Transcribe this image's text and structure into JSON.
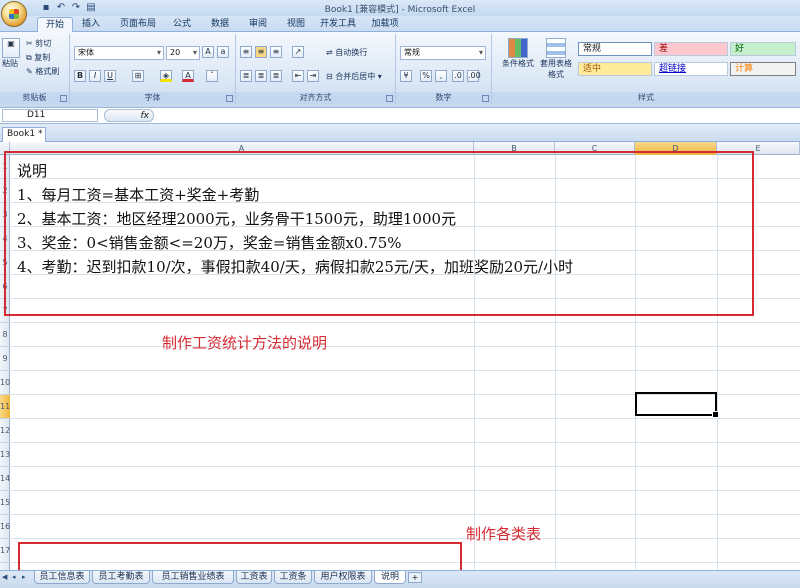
{
  "window": {
    "title": "Book1 [兼容模式] - Microsoft Excel"
  },
  "ribbon": {
    "tabs": [
      "开始",
      "插入",
      "页面布局",
      "公式",
      "数据",
      "审阅",
      "视图",
      "开发工具",
      "加载项"
    ],
    "clipboard": {
      "paste": "粘贴",
      "cut": "剪切",
      "copy": "复制",
      "format_painter": "格式刷",
      "label": "剪贴板"
    },
    "font": {
      "name": "宋体",
      "size": "20",
      "label": "字体"
    },
    "alignment": {
      "wrap": "自动换行",
      "merge": "合并后居中",
      "label": "对齐方式"
    },
    "number": {
      "format": "常规",
      "label": "数字"
    },
    "styles": {
      "conditional": "条件格式",
      "table_format": "套用表格格式",
      "cells": [
        "常规",
        "差",
        "好",
        "适中",
        "超链接",
        "计算"
      ],
      "label": "样式"
    }
  },
  "formula_bar": {
    "name_box": "D11",
    "fx": "fx"
  },
  "workbook_tab": "Book1 *",
  "grid": {
    "columns": [
      "A",
      "B",
      "C",
      "D",
      "E"
    ],
    "rows": [
      "1",
      "2",
      "3",
      "4",
      "5",
      "6",
      "7",
      "8",
      "9",
      "10",
      "11",
      "12",
      "13",
      "14",
      "15",
      "16",
      "17"
    ],
    "active_cell": "D11"
  },
  "content": {
    "lines": [
      "说明",
      "1、每月工资=基本工资+奖金+考勤",
      "2、基本工资：地区经理2000元，业务骨干1500元，助理1000元",
      "3、奖金：0<销售金额<=20万，奖金=销售金额x0.75%",
      "4、考勤：迟到扣款10/次，事假扣款40/天，病假扣款25元/天，加班奖励20元/小时"
    ]
  },
  "annotations": {
    "method": "制作工资统计方法的说明",
    "tables": "制作各类表"
  },
  "sheets": [
    "员工信息表",
    "员工考勤表",
    "员工销售业绩表",
    "工资表",
    "工资条",
    "用户权限表",
    "说明"
  ],
  "active_sheet": "说明",
  "colors": {
    "annotation_red": "#d42a32",
    "selected_header": "#f1b63c"
  }
}
